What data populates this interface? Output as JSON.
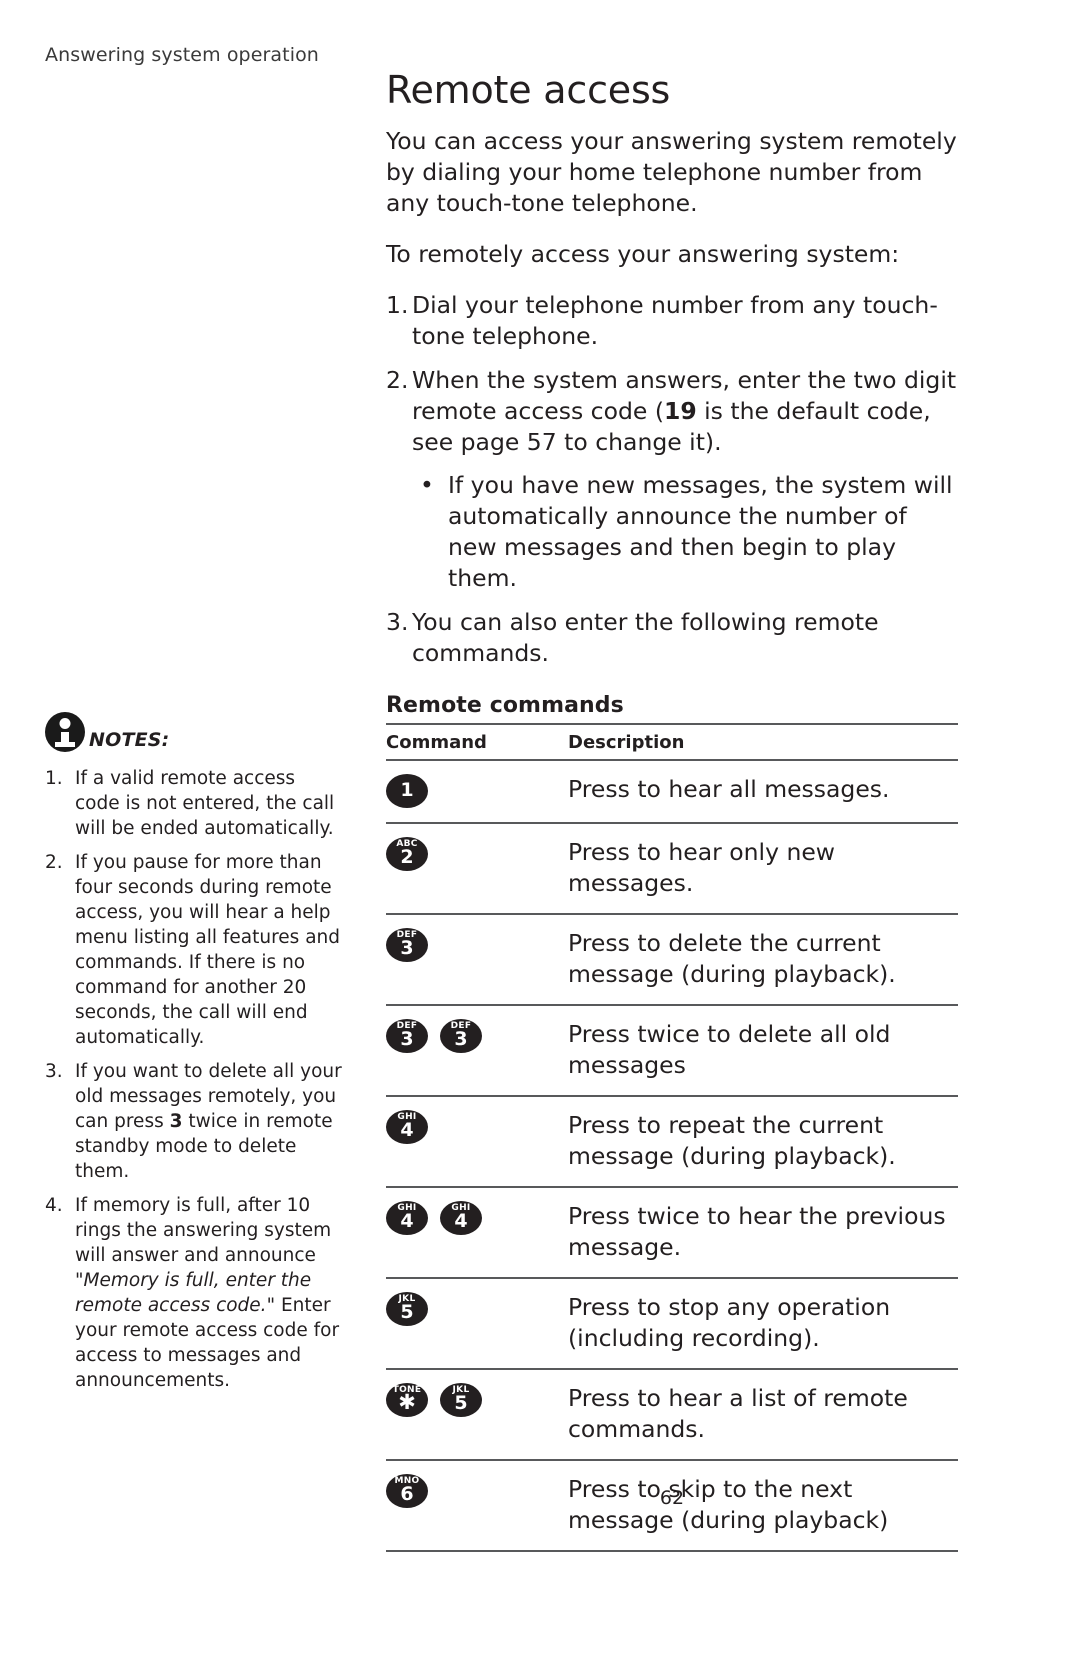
{
  "running_header": "Answering system operation",
  "page_number": "62",
  "main": {
    "title": "Remote access",
    "intro": "You can access your answering system remotely by dialing your home telephone number from any touch-tone telephone.",
    "lead_in": "To remotely access your answering system:",
    "steps": [
      {
        "num": "1.",
        "text_before": "Dial your telephone number from any touch-tone telephone.",
        "bold": "",
        "text_after": ""
      },
      {
        "num": "2.",
        "text_before": "When the system answers, enter the two digit remote access code (",
        "bold": "19",
        "text_after": " is the default code, see page 57 to change it).",
        "bullets": [
          "If you have new messages, the system will automatically announce the number of new messages and then begin to play them."
        ]
      },
      {
        "num": "3.",
        "text_before": "You can also enter the following remote commands.",
        "bold": "",
        "text_after": ""
      }
    ],
    "table": {
      "heading": "Remote commands",
      "columns": [
        "Command",
        "Description"
      ],
      "rows": [
        {
          "keys": [
            {
              "letters": "",
              "digit": "1"
            }
          ],
          "description": "Press to hear all messages."
        },
        {
          "keys": [
            {
              "letters": "ABC",
              "digit": "2"
            }
          ],
          "description": "Press to hear only new messages."
        },
        {
          "keys": [
            {
              "letters": "DEF",
              "digit": "3"
            }
          ],
          "description": "Press to delete the current message (during playback)."
        },
        {
          "keys": [
            {
              "letters": "DEF",
              "digit": "3"
            },
            {
              "letters": "DEF",
              "digit": "3"
            }
          ],
          "description": "Press twice to delete all old messages"
        },
        {
          "keys": [
            {
              "letters": "GHI",
              "digit": "4"
            }
          ],
          "description": "Press to repeat the current message (during playback)."
        },
        {
          "keys": [
            {
              "letters": "GHI",
              "digit": "4"
            },
            {
              "letters": "GHI",
              "digit": "4"
            }
          ],
          "description": "Press twice to hear the previous message."
        },
        {
          "keys": [
            {
              "letters": "JKL",
              "digit": "5"
            }
          ],
          "description": "Press to stop any operation (including recording)."
        },
        {
          "keys": [
            {
              "letters": "TONE",
              "digit": "✱"
            },
            {
              "letters": "JKL",
              "digit": "5"
            }
          ],
          "description": "Press to hear a list of remote commands."
        },
        {
          "keys": [
            {
              "letters": "MNO",
              "digit": "6"
            }
          ],
          "description": "Press to skip to the next message (during playback)"
        }
      ]
    }
  },
  "sidebar": {
    "notes_label": "NOTES:",
    "notes": [
      {
        "num": "1.",
        "parts": [
          {
            "type": "plain",
            "text": "If a valid remote access code is not entered, the call will be ended automatically."
          }
        ]
      },
      {
        "num": "2.",
        "parts": [
          {
            "type": "plain",
            "text": "If you pause for more than four seconds during remote access, you will hear a help menu listing all features and commands. If there is no command for another 20 seconds, the call will end automatically."
          }
        ]
      },
      {
        "num": "3.",
        "parts": [
          {
            "type": "plain",
            "text": "If you want to delete all your old messages remotely, you can press "
          },
          {
            "type": "bold",
            "text": "3"
          },
          {
            "type": "plain",
            "text": " twice in remote standby mode to delete them."
          }
        ]
      },
      {
        "num": "4.",
        "parts": [
          {
            "type": "plain",
            "text": "If memory is full, after 10 rings the answering system will answer and announce \""
          },
          {
            "type": "italic",
            "text": "Memory is full, enter the remote access code."
          },
          {
            "type": "plain",
            "text": "\" Enter your remote access code for access to messages and announcements."
          }
        ]
      }
    ]
  }
}
